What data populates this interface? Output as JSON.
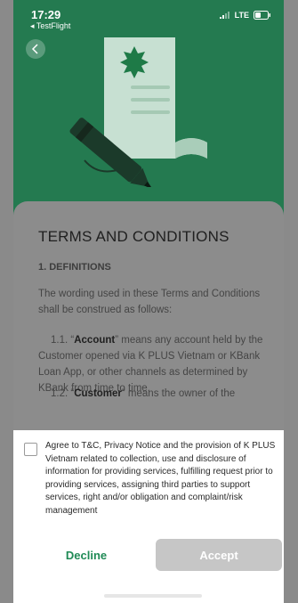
{
  "status": {
    "time": "17:29",
    "back_app": "◂ TestFlight",
    "network": "LTE"
  },
  "content": {
    "title": "TERMS AND CONDITIONS",
    "section_heading": "1. DEFINITIONS",
    "intro": "The wording used in these Terms and Conditions shall be construed as follows:",
    "item_1_prefix": "1.1. “",
    "item_1_term": "Account",
    "item_1_text": "” means any account held by the Customer opened via K PLUS Vietnam or KBank Loan App, or other channels as determined by KBank from time to time.",
    "item_2_prefix": "1.2. “",
    "item_2_term": "Customer",
    "item_2_text": "” means the owner of the"
  },
  "footer": {
    "consent_text": "Agree to T&C, Privacy Notice and the provision of K PLUS Vietnam related to collection, use and disclosure of information for providing services, fulfilling request prior to providing services, assigning third parties to support services, right and/or obligation and  complaint/risk management",
    "decline_label": "Decline",
    "accept_label": "Accept"
  },
  "colors": {
    "brand_green": "#247a50",
    "decline_text": "#1f8a55",
    "accept_disabled": "#c6c6c6"
  }
}
